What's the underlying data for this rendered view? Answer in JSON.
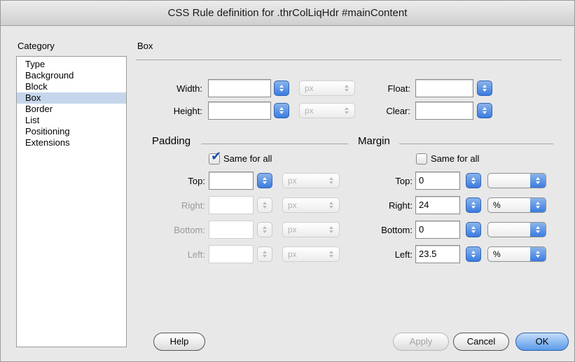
{
  "window": {
    "title": "CSS Rule definition for .thrColLiqHdr #mainContent"
  },
  "category": {
    "header": "Category",
    "items": [
      "Type",
      "Background",
      "Block",
      "Box",
      "Border",
      "List",
      "Positioning",
      "Extensions"
    ],
    "selected": "Box"
  },
  "panel": {
    "title": "Box",
    "width": {
      "label": "Width:",
      "value": "",
      "unit": "px"
    },
    "height": {
      "label": "Height:",
      "value": "",
      "unit": "px"
    },
    "float": {
      "label": "Float:",
      "value": ""
    },
    "clear": {
      "label": "Clear:",
      "value": ""
    },
    "padding": {
      "title": "Padding",
      "same_for_all": {
        "label": "Same for all",
        "checked": true
      },
      "top": {
        "label": "Top:",
        "value": "",
        "unit": "px"
      },
      "right": {
        "label": "Right:",
        "value": "",
        "unit": "px"
      },
      "bottom": {
        "label": "Bottom:",
        "value": "",
        "unit": "px"
      },
      "left": {
        "label": "Left:",
        "value": "",
        "unit": "px"
      }
    },
    "margin": {
      "title": "Margin",
      "same_for_all": {
        "label": "Same for all",
        "checked": false
      },
      "top": {
        "label": "Top:",
        "value": "0",
        "unit": ""
      },
      "right": {
        "label": "Right:",
        "value": "24",
        "unit": "%"
      },
      "bottom": {
        "label": "Bottom:",
        "value": "0",
        "unit": ""
      },
      "left": {
        "label": "Left:",
        "value": "23.5",
        "unit": "%"
      }
    }
  },
  "buttons": {
    "help": "Help",
    "apply": "Apply",
    "cancel": "Cancel",
    "ok": "OK"
  }
}
